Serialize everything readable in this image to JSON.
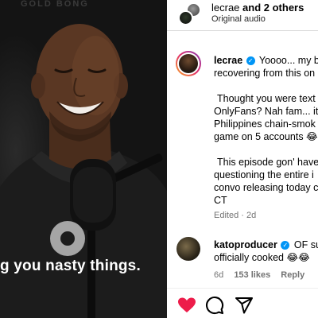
{
  "video": {
    "watermark": "GOLD BONG",
    "caption": "g you nasty things."
  },
  "header": {
    "user_name": "lecrae",
    "others_text": "and 2 others",
    "audio_label": "Original audio"
  },
  "comments": [
    {
      "username": "lecrae",
      "verified": true,
      "lines": [
        "Yoooo... my b",
        "recovering from this on",
        "",
        "Thought you were text",
        "OnlyFans? Nah fam... it",
        "Philippines chain-smok",
        "game on 5 accounts 😂",
        "",
        "This episode gon' have",
        "questioning the entire i",
        "convo releasing today c",
        "CT"
      ],
      "meta": "Edited · 2d"
    },
    {
      "username": "katoproducer",
      "verified": true,
      "lines": [
        "OF su",
        "officially cooked 😂😂"
      ],
      "time": "6d",
      "likes": "153 likes",
      "reply": "Reply"
    }
  ],
  "actions": {
    "like_icon": "heart-icon",
    "comment_icon": "comment-icon",
    "share_icon": "share-icon",
    "like_color": "#ed1c4a"
  }
}
